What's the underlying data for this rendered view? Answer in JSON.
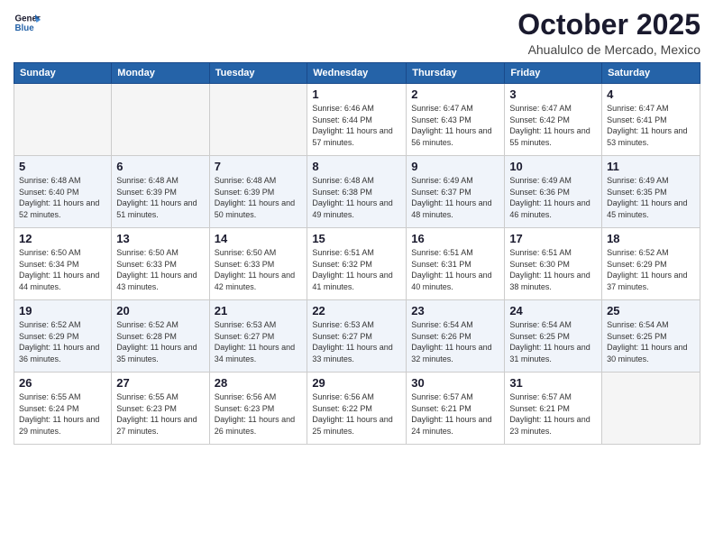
{
  "logo": {
    "line1": "General",
    "line2": "Blue"
  },
  "title": "October 2025",
  "subtitle": "Ahualulco de Mercado, Mexico",
  "days_header": [
    "Sunday",
    "Monday",
    "Tuesday",
    "Wednesday",
    "Thursday",
    "Friday",
    "Saturday"
  ],
  "weeks": [
    [
      {
        "day": "",
        "info": ""
      },
      {
        "day": "",
        "info": ""
      },
      {
        "day": "",
        "info": ""
      },
      {
        "day": "1",
        "info": "Sunrise: 6:46 AM\nSunset: 6:44 PM\nDaylight: 11 hours and 57 minutes."
      },
      {
        "day": "2",
        "info": "Sunrise: 6:47 AM\nSunset: 6:43 PM\nDaylight: 11 hours and 56 minutes."
      },
      {
        "day": "3",
        "info": "Sunrise: 6:47 AM\nSunset: 6:42 PM\nDaylight: 11 hours and 55 minutes."
      },
      {
        "day": "4",
        "info": "Sunrise: 6:47 AM\nSunset: 6:41 PM\nDaylight: 11 hours and 53 minutes."
      }
    ],
    [
      {
        "day": "5",
        "info": "Sunrise: 6:48 AM\nSunset: 6:40 PM\nDaylight: 11 hours and 52 minutes."
      },
      {
        "day": "6",
        "info": "Sunrise: 6:48 AM\nSunset: 6:39 PM\nDaylight: 11 hours and 51 minutes."
      },
      {
        "day": "7",
        "info": "Sunrise: 6:48 AM\nSunset: 6:39 PM\nDaylight: 11 hours and 50 minutes."
      },
      {
        "day": "8",
        "info": "Sunrise: 6:48 AM\nSunset: 6:38 PM\nDaylight: 11 hours and 49 minutes."
      },
      {
        "day": "9",
        "info": "Sunrise: 6:49 AM\nSunset: 6:37 PM\nDaylight: 11 hours and 48 minutes."
      },
      {
        "day": "10",
        "info": "Sunrise: 6:49 AM\nSunset: 6:36 PM\nDaylight: 11 hours and 46 minutes."
      },
      {
        "day": "11",
        "info": "Sunrise: 6:49 AM\nSunset: 6:35 PM\nDaylight: 11 hours and 45 minutes."
      }
    ],
    [
      {
        "day": "12",
        "info": "Sunrise: 6:50 AM\nSunset: 6:34 PM\nDaylight: 11 hours and 44 minutes."
      },
      {
        "day": "13",
        "info": "Sunrise: 6:50 AM\nSunset: 6:33 PM\nDaylight: 11 hours and 43 minutes."
      },
      {
        "day": "14",
        "info": "Sunrise: 6:50 AM\nSunset: 6:33 PM\nDaylight: 11 hours and 42 minutes."
      },
      {
        "day": "15",
        "info": "Sunrise: 6:51 AM\nSunset: 6:32 PM\nDaylight: 11 hours and 41 minutes."
      },
      {
        "day": "16",
        "info": "Sunrise: 6:51 AM\nSunset: 6:31 PM\nDaylight: 11 hours and 40 minutes."
      },
      {
        "day": "17",
        "info": "Sunrise: 6:51 AM\nSunset: 6:30 PM\nDaylight: 11 hours and 38 minutes."
      },
      {
        "day": "18",
        "info": "Sunrise: 6:52 AM\nSunset: 6:29 PM\nDaylight: 11 hours and 37 minutes."
      }
    ],
    [
      {
        "day": "19",
        "info": "Sunrise: 6:52 AM\nSunset: 6:29 PM\nDaylight: 11 hours and 36 minutes."
      },
      {
        "day": "20",
        "info": "Sunrise: 6:52 AM\nSunset: 6:28 PM\nDaylight: 11 hours and 35 minutes."
      },
      {
        "day": "21",
        "info": "Sunrise: 6:53 AM\nSunset: 6:27 PM\nDaylight: 11 hours and 34 minutes."
      },
      {
        "day": "22",
        "info": "Sunrise: 6:53 AM\nSunset: 6:27 PM\nDaylight: 11 hours and 33 minutes."
      },
      {
        "day": "23",
        "info": "Sunrise: 6:54 AM\nSunset: 6:26 PM\nDaylight: 11 hours and 32 minutes."
      },
      {
        "day": "24",
        "info": "Sunrise: 6:54 AM\nSunset: 6:25 PM\nDaylight: 11 hours and 31 minutes."
      },
      {
        "day": "25",
        "info": "Sunrise: 6:54 AM\nSunset: 6:25 PM\nDaylight: 11 hours and 30 minutes."
      }
    ],
    [
      {
        "day": "26",
        "info": "Sunrise: 6:55 AM\nSunset: 6:24 PM\nDaylight: 11 hours and 29 minutes."
      },
      {
        "day": "27",
        "info": "Sunrise: 6:55 AM\nSunset: 6:23 PM\nDaylight: 11 hours and 27 minutes."
      },
      {
        "day": "28",
        "info": "Sunrise: 6:56 AM\nSunset: 6:23 PM\nDaylight: 11 hours and 26 minutes."
      },
      {
        "day": "29",
        "info": "Sunrise: 6:56 AM\nSunset: 6:22 PM\nDaylight: 11 hours and 25 minutes."
      },
      {
        "day": "30",
        "info": "Sunrise: 6:57 AM\nSunset: 6:21 PM\nDaylight: 11 hours and 24 minutes."
      },
      {
        "day": "31",
        "info": "Sunrise: 6:57 AM\nSunset: 6:21 PM\nDaylight: 11 hours and 23 minutes."
      },
      {
        "day": "",
        "info": ""
      }
    ]
  ]
}
